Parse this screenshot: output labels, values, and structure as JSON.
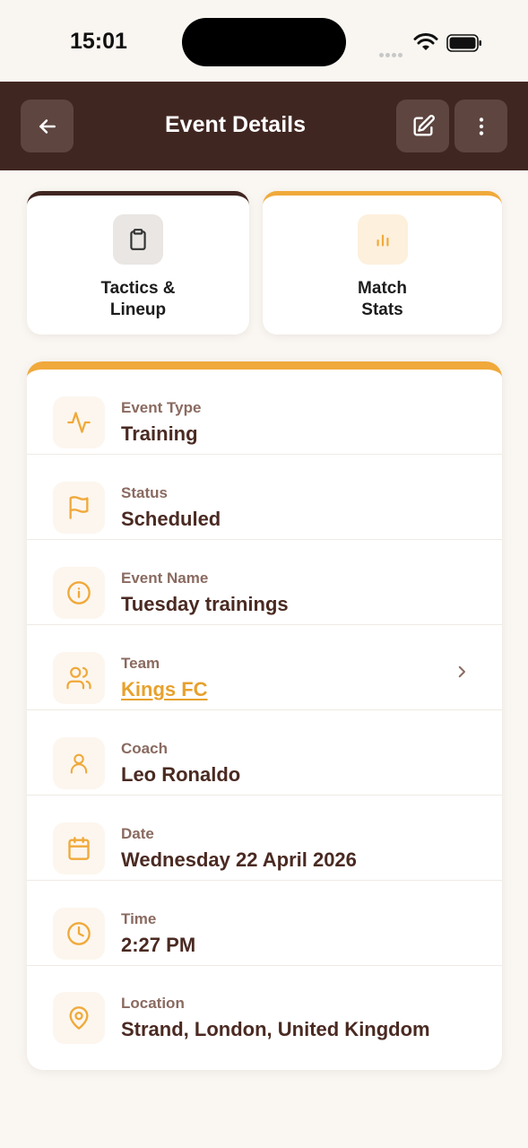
{
  "status_bar": {
    "time": "15:01"
  },
  "header": {
    "title": "Event Details"
  },
  "quick_actions": [
    {
      "label": "Tactics &\nLineup",
      "icon": "clipboard-icon"
    },
    {
      "label": "Match\nStats",
      "icon": "bar-chart-icon"
    }
  ],
  "details": [
    {
      "label": "Event Type",
      "value": "Training",
      "icon": "activity-icon"
    },
    {
      "label": "Status",
      "value": "Scheduled",
      "icon": "flag-icon"
    },
    {
      "label": "Event Name",
      "value": "Tuesday trainings",
      "icon": "info-icon"
    },
    {
      "label": "Team",
      "value": "Kings FC",
      "icon": "users-icon",
      "link": true
    },
    {
      "label": "Coach",
      "value": "Leo Ronaldo",
      "icon": "user-icon"
    },
    {
      "label": "Date",
      "value": "Wednesday 22 April 2026",
      "icon": "calendar-icon"
    },
    {
      "label": "Time",
      "value": "2:27 PM",
      "icon": "clock-icon"
    },
    {
      "label": "Location",
      "value": "Strand, London, United Kingdom",
      "icon": "map-pin-icon"
    }
  ],
  "colors": {
    "header_bg": "#402621",
    "accent": "#f0a93a",
    "text_dark": "#4a2a22",
    "label_muted": "#8a6a60"
  }
}
